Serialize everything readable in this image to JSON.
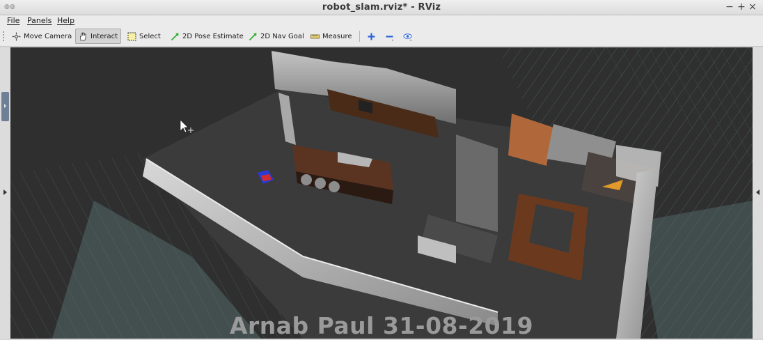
{
  "window": {
    "title": "robot_slam.rviz* - RViz",
    "controls": [
      "−",
      "+",
      "×"
    ]
  },
  "menubar": {
    "items": [
      "File",
      "Panels",
      "Help"
    ]
  },
  "toolbar": {
    "tools": [
      {
        "label": "Move Camera",
        "icon": "move-camera-icon",
        "active": false
      },
      {
        "label": "Interact",
        "icon": "hand-icon",
        "active": true
      },
      {
        "label": "Select",
        "icon": "select-box-icon",
        "active": false
      },
      {
        "label": "2D Pose Estimate",
        "icon": "green-arrow-icon",
        "active": false
      },
      {
        "label": "2D Nav Goal",
        "icon": "green-arrow-icon",
        "active": false
      },
      {
        "label": "Measure",
        "icon": "ruler-icon",
        "active": false
      }
    ],
    "extra_icons": [
      "add-tool-icon",
      "remove-tool-icon",
      "camera-view-icon"
    ]
  },
  "viewport": {
    "watermark": "Arnab Paul 31-08-2019"
  },
  "colors": {
    "viewport_bg": "#2f2f2f",
    "floor": "#3a3a3a",
    "wall": "#b5b5b5",
    "wood": "#6b3a1e",
    "grid_cyan": "#6f8c8c",
    "robot_blue": "#2a3bd8",
    "robot_red": "#d42b2b",
    "tool_green": "#2fae2f"
  }
}
